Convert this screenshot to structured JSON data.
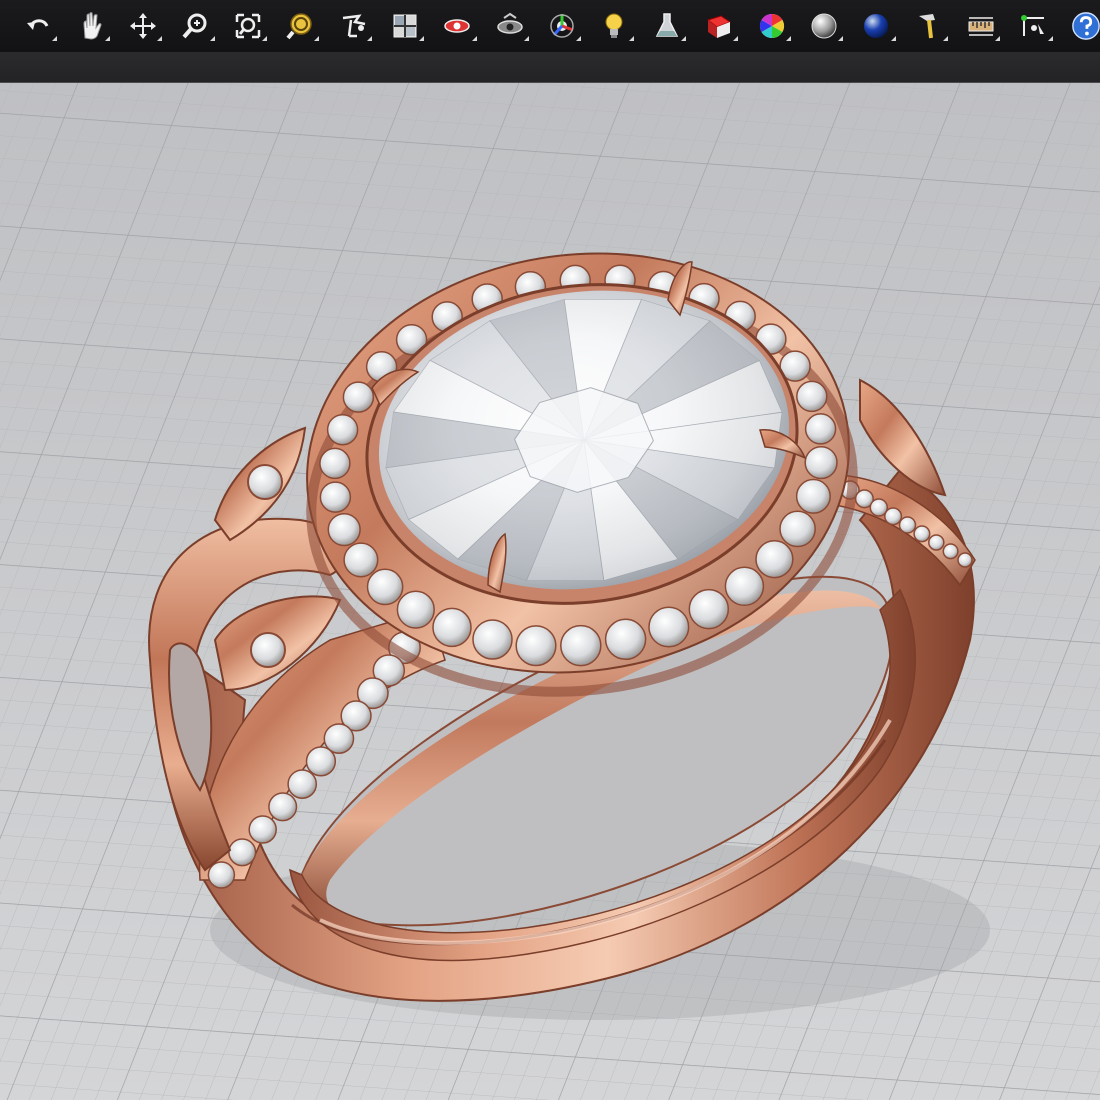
{
  "toolbar": {
    "tools": [
      {
        "name": "undo-icon",
        "kind": "undo"
      },
      {
        "name": "pan-hand-icon",
        "kind": "hand"
      },
      {
        "name": "move-icon",
        "kind": "move"
      },
      {
        "name": "zoom-icon",
        "kind": "zoom"
      },
      {
        "name": "zoom-extents-icon",
        "kind": "zoomext"
      },
      {
        "name": "zoom-selected-icon",
        "kind": "zoomsel"
      },
      {
        "name": "construction-plane-icon",
        "kind": "cplane"
      },
      {
        "name": "four-viewports-icon",
        "kind": "grid4"
      },
      {
        "name": "wireframe-view-icon",
        "kind": "eye-red"
      },
      {
        "name": "shaded-view-icon",
        "kind": "eye-grey"
      },
      {
        "name": "gumball-icon",
        "kind": "gumball"
      },
      {
        "name": "lightbulb-icon",
        "kind": "bulb"
      },
      {
        "name": "render-flask-icon",
        "kind": "flask"
      },
      {
        "name": "layer-book-icon",
        "kind": "book"
      },
      {
        "name": "color-wheel-icon",
        "kind": "wheel"
      },
      {
        "name": "material-sphere-silver-icon",
        "kind": "sphere-silver"
      },
      {
        "name": "material-sphere-blue-icon",
        "kind": "sphere-blue"
      },
      {
        "name": "tools-hammer-icon",
        "kind": "hammer"
      },
      {
        "name": "dimension-ruler-icon",
        "kind": "ruler"
      },
      {
        "name": "snap-points-icon",
        "kind": "snap"
      },
      {
        "name": "help-icon",
        "kind": "help"
      }
    ]
  },
  "colors": {
    "toolbar_bg": "#161618",
    "viewport_bg": "#c9cacc",
    "grid_line": "#aeb0b3",
    "rose_gold": "#c98567",
    "rose_gold_dark": "#8c4a36",
    "rose_gold_light": "#f3c3a8",
    "diamond": "#f1f2f4",
    "help_blue": "#2f6fd6"
  }
}
